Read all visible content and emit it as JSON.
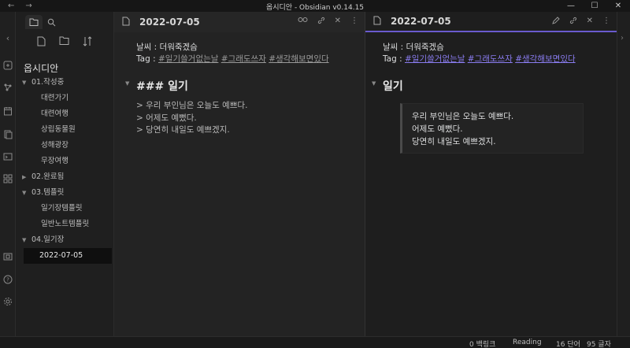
{
  "window": {
    "title": "옵시디안 - Obsidian v0.14.15",
    "nav_back": "←",
    "nav_forward": "→",
    "min": "—",
    "max": "☐",
    "close": "✕"
  },
  "ribbon": {
    "icons": [
      "collapse-left-icon",
      "open-quick-switcher-icon",
      "graph-view-icon",
      "daily-note-icon",
      "templates-icon",
      "command-palette-icon",
      "slides-icon",
      "vault-icon",
      "help-icon",
      "settings-icon"
    ]
  },
  "sidebar": {
    "vault_name": "옵시디안",
    "items": [
      {
        "type": "folder",
        "label": "01.작성중",
        "open": true
      },
      {
        "type": "file",
        "label": "대련가기"
      },
      {
        "type": "file",
        "label": "대련여행"
      },
      {
        "type": "file",
        "label": "상립동물원"
      },
      {
        "type": "file",
        "label": "성해광장"
      },
      {
        "type": "file",
        "label": "무장여행"
      },
      {
        "type": "folder",
        "label": "02.완료됨",
        "open": false
      },
      {
        "type": "folder",
        "label": "03.템플릿",
        "open": true
      },
      {
        "type": "file",
        "label": "일기장템플릿"
      },
      {
        "type": "file",
        "label": "일반노트템플릿"
      },
      {
        "type": "folder",
        "label": "04.일기장",
        "open": true
      },
      {
        "type": "file",
        "label": "2022-07-05",
        "active": true
      }
    ]
  },
  "left_pane": {
    "title": "2022-07-05",
    "weather": "날씨 : 더워죽겠슴",
    "tag_prefix": "Tag : ",
    "tags": [
      "#일기쓸거없는날",
      "#그래도쓰자",
      "#생각해보면있다"
    ],
    "heading": "### 일기",
    "quote_lines": [
      "> 우리 부인님은 오늘도 예쁘다.",
      "> 어제도 예뻤다.",
      "> 당연히 내일도 예쁘겠지."
    ]
  },
  "right_pane": {
    "title": "2022-07-05",
    "weather": "날씨 : 더워죽겠슴",
    "tag_prefix": "Tag : ",
    "tags": [
      "#일기쓸거없는날",
      "#그래도쓰자",
      "#생각해보면있다"
    ],
    "heading": "일기",
    "quote_lines": [
      "우리 부인님은 오늘도 예쁘다.",
      "어제도 예뻤다.",
      "당연히 내일도 예쁘겠지."
    ]
  },
  "status": {
    "backlinks": "0 백링크",
    "mode": "Reading",
    "words": "16 단어",
    "chars": "95 글자"
  },
  "colors": {
    "accent": "#6a5acd",
    "tag_link": "#8a7cf0"
  }
}
